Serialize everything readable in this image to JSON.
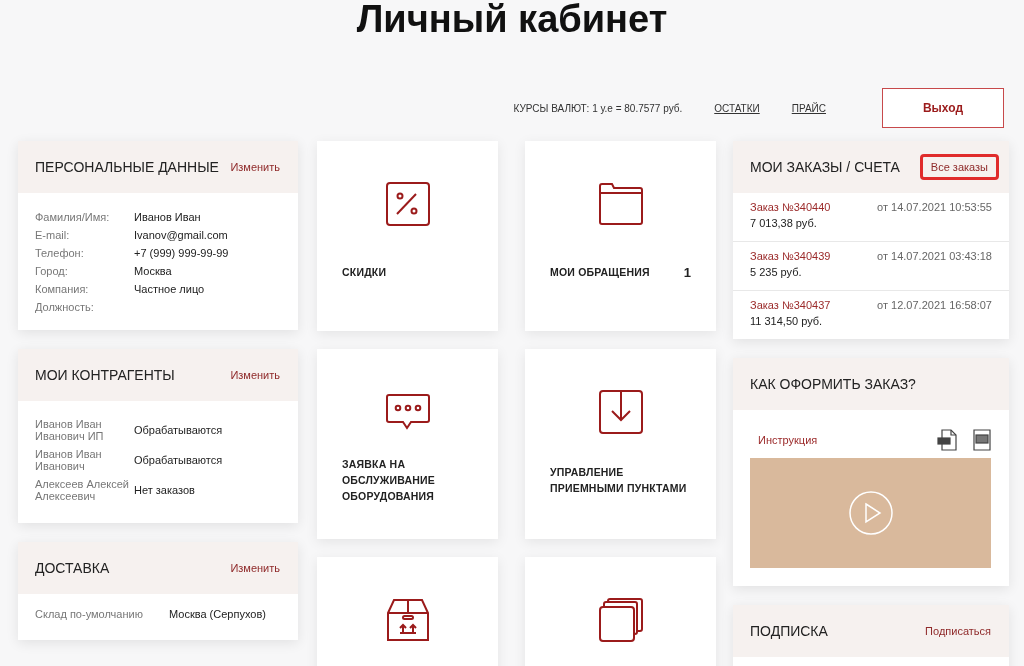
{
  "page": {
    "title": "Личный кабинет"
  },
  "top_bar": {
    "currency_rate": "КУРСЫ ВАЛЮТ: 1 у.е = 80.7577 руб.",
    "links": [
      "ОСТАТКИ",
      "ПРАЙС"
    ],
    "logout_button": "Выход"
  },
  "personal_data": {
    "title": "ПЕРСОНАЛЬНЫЕ ДАННЫЕ",
    "action": "Изменить",
    "fields": [
      {
        "label": "Фамилия/Имя:",
        "value": "Иванов Иван"
      },
      {
        "label": "E-mail:",
        "value": "Ivanov@gmail.com"
      },
      {
        "label": "Телефон:",
        "value": "+7 (999) 999-99-99"
      },
      {
        "label": "Город:",
        "value": "Москва"
      },
      {
        "label": "Компания:",
        "value": "Частное лицо"
      },
      {
        "label": "Должность:"
      }
    ]
  },
  "counterparties": {
    "title": "МОИ КОНТРАГЕНТЫ",
    "action": "Изменить",
    "rows": [
      {
        "name": "Иванов Иван Иванович ИП",
        "status": "Обрабатываются"
      },
      {
        "name": "Иванов Иван Иванович",
        "status": "Обрабатываются"
      },
      {
        "name": "Алексеев Алексей Алексеевич",
        "status": "Нет заказов"
      }
    ]
  },
  "delivery": {
    "title": "ДОСТАВКА",
    "action": "Изменить",
    "rows": [
      {
        "label": "Склад по-умолчанию",
        "value": "Москва (Серпухов)"
      }
    ]
  },
  "tiles": [
    {
      "kind": "percent",
      "label": "СКИДКИ"
    },
    {
      "kind": "folder",
      "label": "МОИ ОБРАЩЕНИЯ",
      "count": "1"
    },
    {
      "kind": "chat",
      "label": "ЗАЯВКА НА ОБСЛУЖИВАНИЕ ОБОРУДОВАНИЯ"
    },
    {
      "kind": "download",
      "label": "УПРАВЛЕНИЕ ПРИЕМНЫМИ ПУНКТАМИ"
    },
    {
      "kind": "box"
    },
    {
      "kind": "stack"
    }
  ],
  "orders": {
    "title": "МОИ ЗАКАЗЫ / СЧЕТА",
    "action": {
      "label": "Все заказы",
      "highlighted": true
    },
    "items": [
      {
        "number": "Заказ №340440",
        "date": "от 14.07.2021 10:53:55",
        "amount": "7 013,38 руб."
      },
      {
        "number": "Заказ №340439",
        "date": "от 14.07.2021 03:43:18",
        "amount": "5 235 руб."
      },
      {
        "number": "Заказ №340437",
        "date": "от 12.07.2021 16:58:07",
        "amount": "11 314,50 руб."
      }
    ]
  },
  "how_to_order": {
    "title": "КАК ОФОРМИТЬ ЗАКАЗ?",
    "link": "Инструкция"
  },
  "subscription": {
    "title": "ПОДПИСКА",
    "action": "Подписаться"
  }
}
